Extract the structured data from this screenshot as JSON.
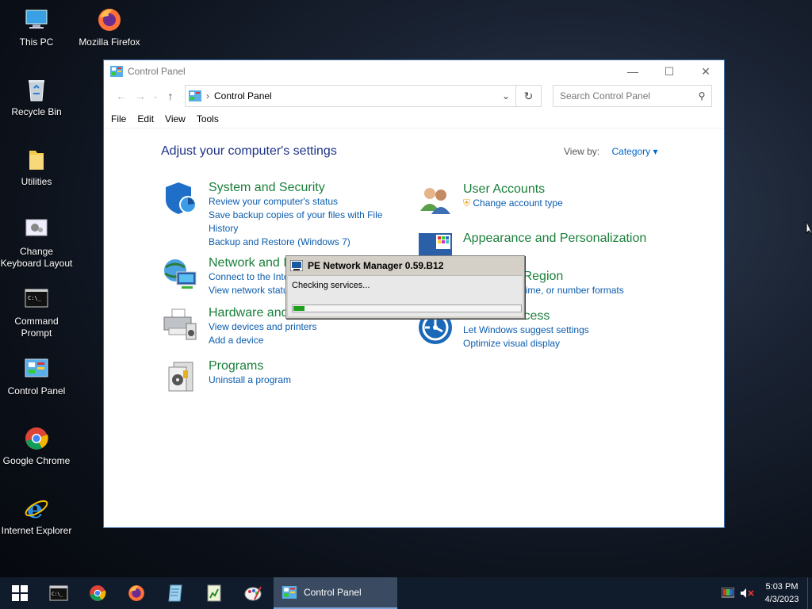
{
  "desktop": {
    "icons": [
      {
        "label": "This PC"
      },
      {
        "label": "Mozilla Firefox"
      },
      {
        "label": "Recycle Bin"
      },
      {
        "label": "Utilities"
      },
      {
        "label": "Change Keyboard Layout"
      },
      {
        "label": "Command Prompt"
      },
      {
        "label": "Control Panel"
      },
      {
        "label": "Google Chrome"
      },
      {
        "label": "Internet Explorer"
      }
    ]
  },
  "window": {
    "title": "Control Panel",
    "controls": {
      "minimize": "—",
      "maximize": "☐",
      "close": "✕"
    },
    "address": {
      "crumb": "Control Panel"
    },
    "search": {
      "placeholder": "Search Control Panel"
    },
    "menu": [
      "File",
      "Edit",
      "View",
      "Tools"
    ],
    "heading": "Adjust your computer's settings",
    "view_by": {
      "label": "View by:",
      "value": "Category"
    },
    "categories": [
      {
        "title": "System and Security",
        "links": [
          "Review your computer's status",
          "Save backup copies of your files with File History",
          "Backup and Restore (Windows 7)"
        ],
        "icon": "shield-icon"
      },
      {
        "title": "Network and Internet",
        "links": [
          "Connect to the Internet",
          "View network status and tasks"
        ],
        "icon": "network-globe-icon"
      },
      {
        "title": "Hardware and Sound",
        "links": [
          "View devices and printers",
          "Add a device"
        ],
        "icon": "printer-icon"
      },
      {
        "title": "Programs",
        "links": [
          "Uninstall a program"
        ],
        "icon": "programs-icon"
      },
      {
        "title": "User Accounts",
        "links": [
          "Change account type"
        ],
        "icon": "users-icon"
      },
      {
        "title": "Appearance and Personalization",
        "links": [],
        "icon": "palette-icon"
      },
      {
        "title": "Clock and Region",
        "links": [
          "Change date, time, or number formats"
        ],
        "icon": "clock-globe-icon"
      },
      {
        "title": "Ease of Access",
        "links": [
          "Let Windows suggest settings",
          "Optimize visual display"
        ],
        "icon": "ease-of-access-icon"
      }
    ]
  },
  "dialog": {
    "title": "PE Network Manager 0.59.B12",
    "status": "Checking services...",
    "progress": 0.05
  },
  "taskbar": {
    "active_label": "Control Panel",
    "time": "5:03 PM",
    "date": "4/3/2023"
  },
  "colors": {
    "category_title": "#1a7f3a",
    "link": "#0b5cad",
    "heading": "#1e3287",
    "progress": "#1ea01e"
  }
}
